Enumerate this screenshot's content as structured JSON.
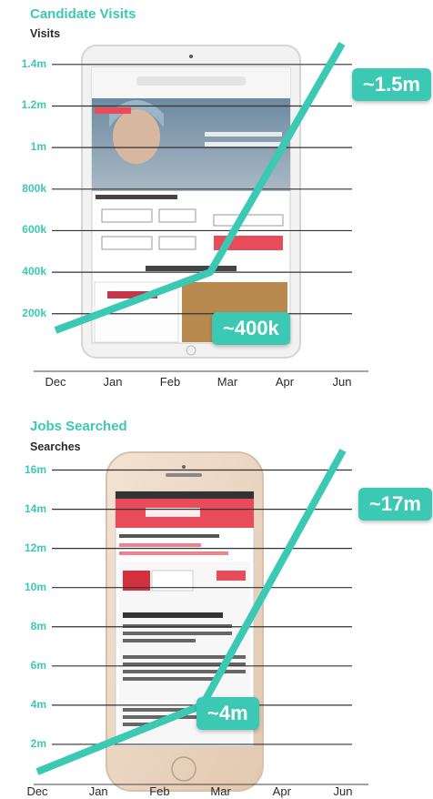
{
  "colors": {
    "accent": "#3cc9b3",
    "gridline": "#333333",
    "text": "#2b2b2b"
  },
  "chart_data": [
    {
      "type": "line",
      "title": "Candidate Visits",
      "ylabel": "Visits",
      "xlabel": "",
      "categories": [
        "Dec",
        "Jan",
        "Feb",
        "Mar",
        "Apr",
        "Jun"
      ],
      "y_ticks": [
        {
          "value": 200000,
          "label": "200k"
        },
        {
          "value": 400000,
          "label": "400k"
        },
        {
          "value": 600000,
          "label": "600k"
        },
        {
          "value": 800000,
          "label": "800k"
        },
        {
          "value": 1000000,
          "label": "1m"
        },
        {
          "value": 1200000,
          "label": "1.2m"
        },
        {
          "value": 1400000,
          "label": "1.4m"
        }
      ],
      "ylim": [
        50000,
        1500000
      ],
      "grid": true,
      "series": [
        {
          "points": [
            [
              0.0,
              120000
            ],
            [
              2.7,
              400000
            ],
            [
              5.0,
              1500000
            ]
          ]
        }
      ],
      "annotations": [
        {
          "label": "~1.5m",
          "x": 5.0,
          "y": 1500000
        },
        {
          "label": "~400k",
          "x": 2.7,
          "y": 400000
        }
      ],
      "background_image": "tablet showing HealthBuzz job search site"
    },
    {
      "type": "line",
      "title": "Jobs Searched",
      "ylabel": "Searches",
      "xlabel": "",
      "categories": [
        "Dec",
        "Jan",
        "Feb",
        "Mar",
        "Apr",
        "Jun"
      ],
      "y_ticks": [
        {
          "value": 2000000,
          "label": "2m"
        },
        {
          "value": 4000000,
          "label": "4m"
        },
        {
          "value": 6000000,
          "label": "6m"
        },
        {
          "value": 8000000,
          "label": "8m"
        },
        {
          "value": 10000000,
          "label": "10m"
        },
        {
          "value": 12000000,
          "label": "12m"
        },
        {
          "value": 14000000,
          "label": "14m"
        },
        {
          "value": 16000000,
          "label": "16m"
        }
      ],
      "ylim": [
        0,
        17000000
      ],
      "grid": true,
      "series": [
        {
          "points": [
            [
              0.0,
              600000
            ],
            [
              2.7,
              4000000
            ],
            [
              5.0,
              17000000
            ]
          ]
        }
      ],
      "annotations": [
        {
          "label": "~17m",
          "x": 5.0,
          "y": 17000000
        },
        {
          "label": "~4m",
          "x": 2.7,
          "y": 4000000
        }
      ],
      "background_image": "smartphone showing HealthBuzz job listing"
    }
  ]
}
